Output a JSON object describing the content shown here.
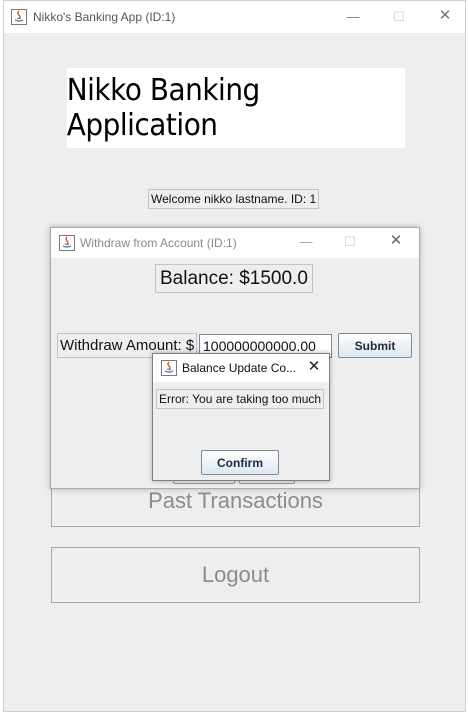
{
  "main_window": {
    "title": "Nikko's Banking App (ID:1)",
    "controls": {
      "minimize": "—",
      "maximize": "☐",
      "close": "✕"
    },
    "banner_text": "Nikko Banking Application",
    "welcome_text": "Welcome nikko lastname. ID: 1",
    "past_transactions_label": "Past Transactions",
    "logout_label": "Logout"
  },
  "withdraw_dialog": {
    "title": "Withdraw from Account (ID:1)",
    "controls": {
      "minimize": "—",
      "maximize": "☐",
      "close": "✕"
    },
    "balance_text": "Balance: $1500.0",
    "amount_label": "Withdraw Amount: $",
    "amount_value": "100000000000.00",
    "submit_label": "Submit"
  },
  "confirm_dialog": {
    "title": "Balance Update Co...",
    "close": "✕",
    "error_text": "Error: You are taking too much",
    "confirm_label": "Confirm"
  },
  "colors": {
    "window_bg": "#eeeeee",
    "title_bar_bg": "#ffffff",
    "label_border": "#b7c7d8",
    "disabled_text": "#8c8c8c",
    "button_text": "#1d2b45"
  }
}
